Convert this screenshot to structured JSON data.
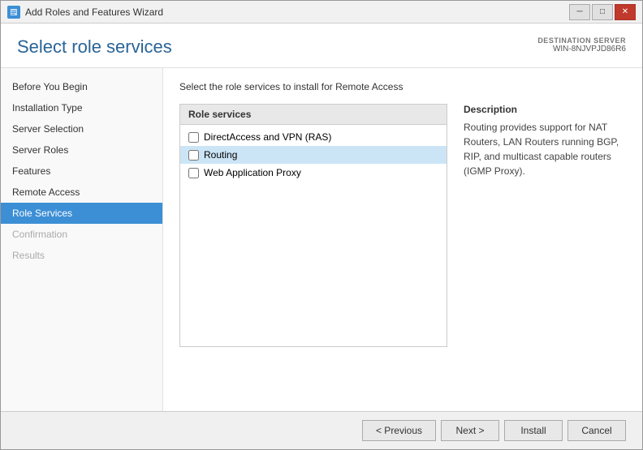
{
  "window": {
    "title": "Add Roles and Features Wizard",
    "icon": "wizard-icon"
  },
  "title_bar_controls": {
    "minimize": "─",
    "maximize": "□",
    "close": "✕"
  },
  "page": {
    "title": "Select role services",
    "destination_server_label": "DESTINATION SERVER",
    "destination_server_name": "WIN-8NJVPJD86R6"
  },
  "instruction": "Select the role services to install for Remote Access",
  "sidebar": {
    "items": [
      {
        "label": "Before You Begin",
        "state": "normal"
      },
      {
        "label": "Installation Type",
        "state": "normal"
      },
      {
        "label": "Server Selection",
        "state": "normal"
      },
      {
        "label": "Server Roles",
        "state": "normal"
      },
      {
        "label": "Features",
        "state": "normal"
      },
      {
        "label": "Remote Access",
        "state": "normal"
      },
      {
        "label": "Role Services",
        "state": "active"
      },
      {
        "label": "Confirmation",
        "state": "disabled"
      },
      {
        "label": "Results",
        "state": "disabled"
      }
    ]
  },
  "role_services": {
    "header": "Role services",
    "items": [
      {
        "label": "DirectAccess and VPN (RAS)",
        "checked": false,
        "selected": false
      },
      {
        "label": "Routing",
        "checked": false,
        "selected": true
      },
      {
        "label": "Web Application Proxy",
        "checked": false,
        "selected": false
      }
    ]
  },
  "description": {
    "header": "Description",
    "text": "Routing provides support for NAT Routers, LAN Routers running BGP, RIP, and multicast capable routers (IGMP Proxy)."
  },
  "footer": {
    "previous": "< Previous",
    "next": "Next >",
    "install": "Install",
    "cancel": "Cancel"
  }
}
